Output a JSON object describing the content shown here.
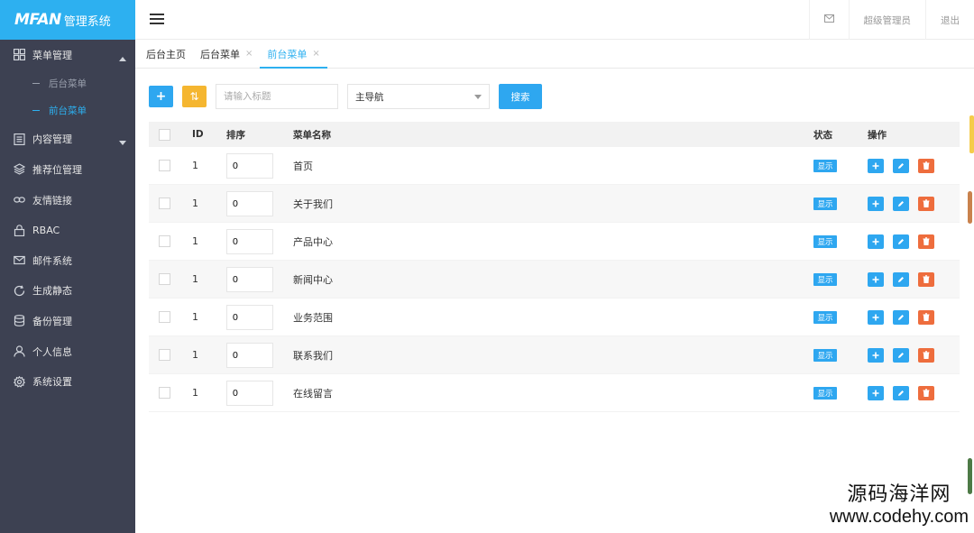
{
  "brand": {
    "logo": "MFAN",
    "system": "管理系统"
  },
  "header": {
    "mail_icon": "mail-icon",
    "user": "超级管理员",
    "logout": "退出"
  },
  "sidebar": {
    "items": [
      {
        "label": "菜单管理",
        "icon": "grid-icon",
        "expanded": true,
        "children": [
          {
            "label": "后台菜单"
          },
          {
            "label": "前台菜单",
            "active": true
          }
        ]
      },
      {
        "label": "内容管理",
        "icon": "document-icon"
      },
      {
        "label": "推荐位管理",
        "icon": "layers-icon"
      },
      {
        "label": "友情链接",
        "icon": "link-icon"
      },
      {
        "label": "RBAC",
        "icon": "lock-icon"
      },
      {
        "label": "邮件系统",
        "icon": "mail-icon"
      },
      {
        "label": "生成静态",
        "icon": "refresh-icon"
      },
      {
        "label": "备份管理",
        "icon": "database-icon"
      },
      {
        "label": "个人信息",
        "icon": "user-icon"
      },
      {
        "label": "系统设置",
        "icon": "gear-icon"
      }
    ]
  },
  "tabs": [
    {
      "label": "后台主页"
    },
    {
      "label": "后台菜单",
      "close": "×"
    },
    {
      "label": "前台菜单",
      "close": "×",
      "active": true
    }
  ],
  "toolbar": {
    "add": "+",
    "sort": "⇅",
    "search_placeholder": "请输入标题",
    "select_value": "主导航",
    "search_button": "搜索"
  },
  "table": {
    "headers": {
      "id": "ID",
      "sort": "排序",
      "name": "菜单名称",
      "status": "状态",
      "ops": "操作"
    },
    "rows": [
      {
        "id": "1",
        "sort": "0",
        "name": "首页",
        "status": "显示"
      },
      {
        "id": "1",
        "sort": "0",
        "name": "关于我们",
        "status": "显示"
      },
      {
        "id": "1",
        "sort": "0",
        "name": "产品中心",
        "status": "显示"
      },
      {
        "id": "1",
        "sort": "0",
        "name": "新闻中心",
        "status": "显示"
      },
      {
        "id": "1",
        "sort": "0",
        "name": "业务范围",
        "status": "显示"
      },
      {
        "id": "1",
        "sort": "0",
        "name": "联系我们",
        "status": "显示"
      },
      {
        "id": "1",
        "sort": "0",
        "name": "在线留言",
        "status": "显示"
      }
    ]
  },
  "watermark": {
    "cn": "源码海洋网",
    "url": "www.codehy.com"
  },
  "colors": {
    "primary": "#2db0f0",
    "sidebar": "#3d4152",
    "warning": "#f5b630",
    "danger": "#ee6d3d"
  }
}
